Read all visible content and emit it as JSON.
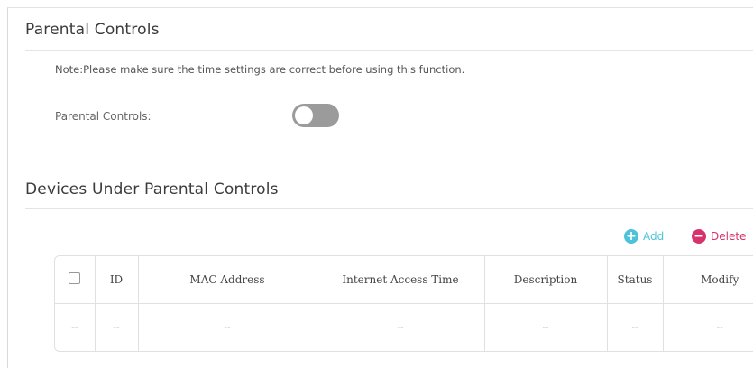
{
  "parental_controls": {
    "title": "Parental Controls",
    "note": "Note:Please make sure the time settings are correct before using this function.",
    "toggle_label": "Parental Controls:",
    "toggle_on": false
  },
  "devices": {
    "title": "Devices Under Parental Controls",
    "add_label": "Add",
    "delete_label": "Delete",
    "columns": [
      "ID",
      "MAC Address",
      "Internet Access Time",
      "Description",
      "Status",
      "Modify"
    ],
    "empty_row": [
      "--",
      "--",
      "--",
      "--",
      "--",
      "--",
      "--"
    ]
  },
  "colors": {
    "add": "#4cc3d9",
    "delete": "#d6336c",
    "toggle_off": "#9b9b9b"
  }
}
